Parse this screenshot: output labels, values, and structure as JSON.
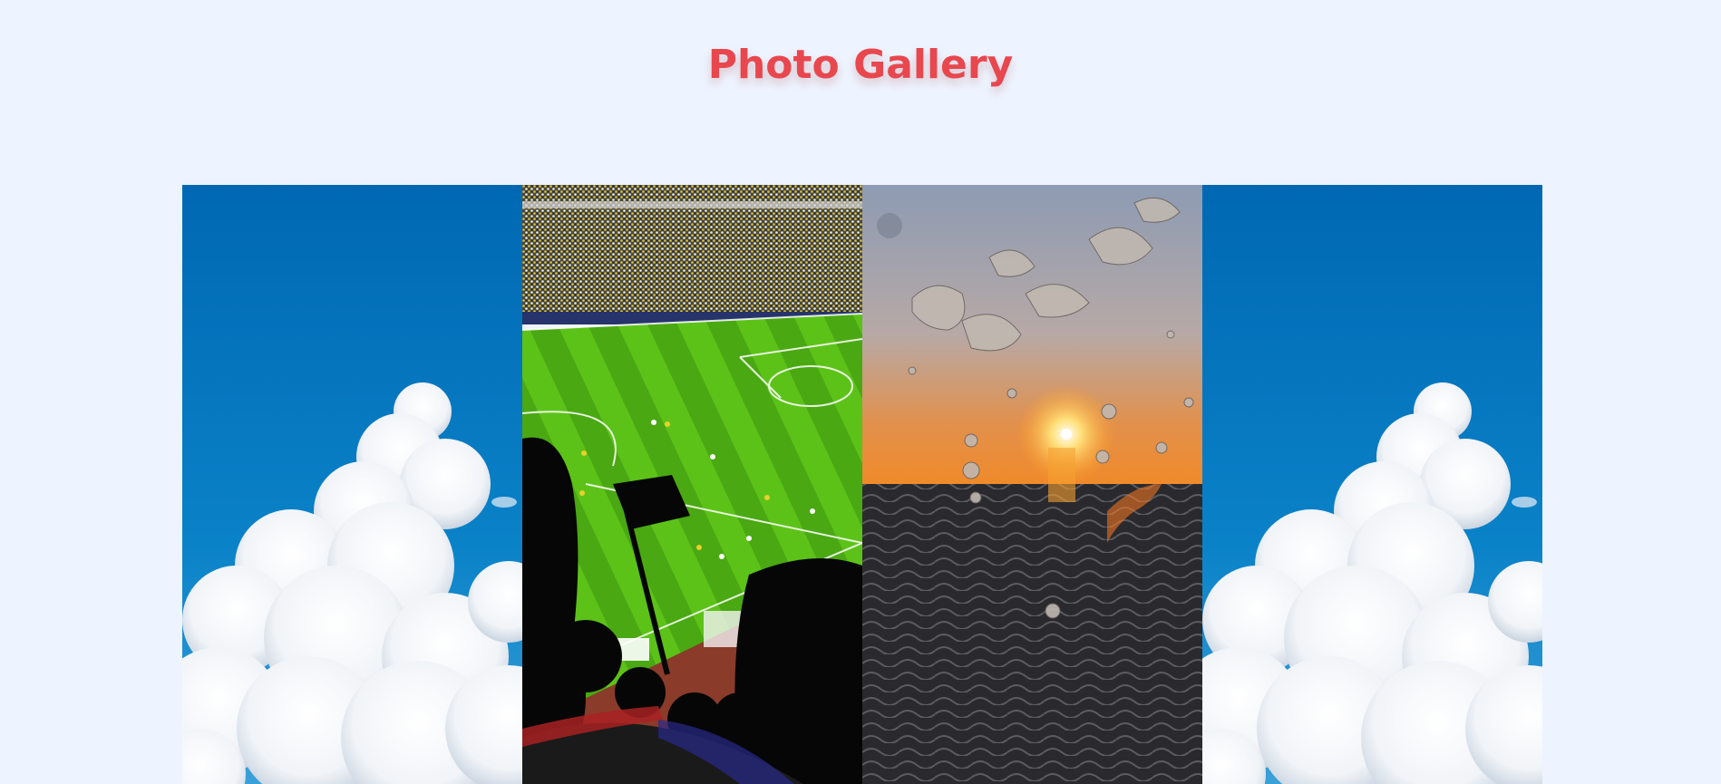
{
  "page": {
    "title": "Photo Gallery",
    "background": "#eef4ff",
    "title_color": "#e8474e"
  },
  "gallery": {
    "photos": [
      {
        "subject": "sky-with-clouds"
      },
      {
        "subject": "football-stadium"
      },
      {
        "subject": "water-splash-sunset"
      },
      {
        "subject": "sky-with-clouds"
      }
    ]
  }
}
